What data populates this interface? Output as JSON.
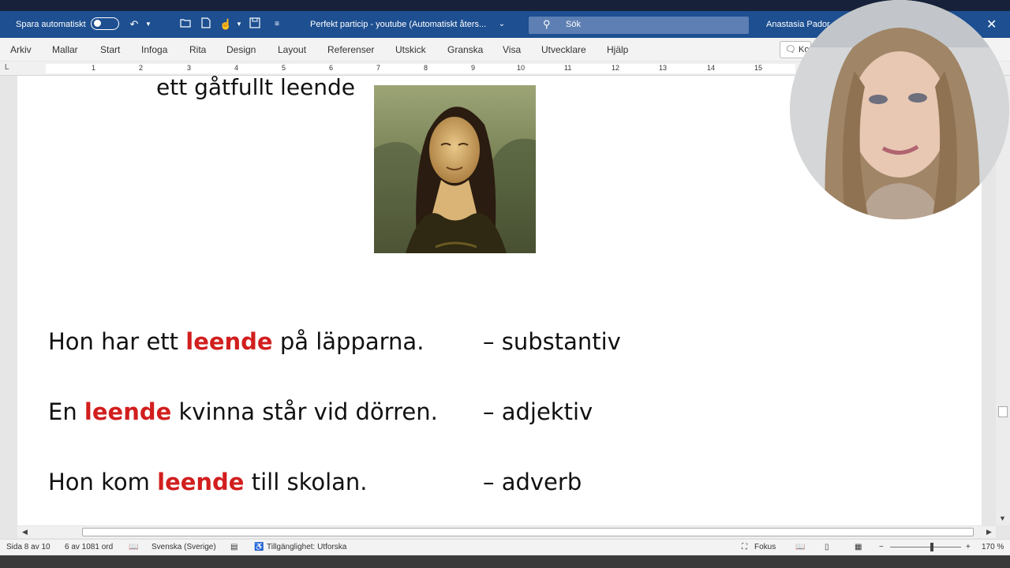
{
  "titlebar": {
    "autosave_label": "Spara automatiskt",
    "document_title": "Perfekt particip - youtube  (Automatiskt åters...",
    "search_placeholder": "Sök",
    "user_name": "Anastasia Pador"
  },
  "menu": {
    "items": [
      "Arkiv",
      "Mallar",
      "Start",
      "Infoga",
      "Rita",
      "Design",
      "Layout",
      "Referenser",
      "Utskick",
      "Granska",
      "Visa",
      "Utvecklare",
      "Hjälp"
    ],
    "comment_label": "Ko"
  },
  "ruler": {
    "tab_marker": "L",
    "numbers": [
      "1",
      "2",
      "3",
      "4",
      "5",
      "6",
      "7",
      "8",
      "9",
      "10",
      "11",
      "12",
      "13",
      "14",
      "15"
    ]
  },
  "document": {
    "phrase": "ett gåtfullt leende",
    "sentences": [
      {
        "before": "Hon har ett ",
        "highlight": "leende",
        "after": " på läpparna.",
        "part_of_speech": "– substantiv"
      },
      {
        "before": "En ",
        "highlight": "leende",
        "after": " kvinna står vid dörren.",
        "part_of_speech": "– adjektiv"
      },
      {
        "before": "Hon kom ",
        "highlight": "leende",
        "after": " till skolan.",
        "part_of_speech": "– adverb"
      }
    ],
    "highlight_color": "#d21e1e"
  },
  "statusbar": {
    "page": "Sida 8 av 10",
    "words": "6 av 1081 ord",
    "language": "Svenska (Sverige)",
    "accessibility": "Tillgänglighet: Utforska",
    "focus": "Fokus",
    "zoom": "170 %"
  },
  "colors": {
    "titlebar": "#1d4f91",
    "search_box": "#5d7fb3"
  }
}
